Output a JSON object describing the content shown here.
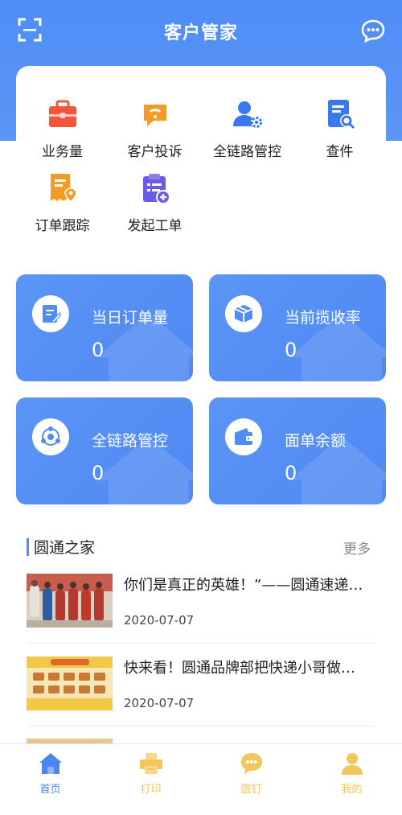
{
  "header": {
    "title": "客户管家",
    "scan_icon": "scan-icon",
    "chat_icon": "chat-bubble-icon"
  },
  "menu": {
    "items": [
      {
        "label": "业务量",
        "icon": "briefcase-icon",
        "color": "#f2553c"
      },
      {
        "label": "客户投诉",
        "icon": "complaint-chat-icon",
        "color": "#f59a22"
      },
      {
        "label": "全链路管控",
        "icon": "user-gear-icon",
        "color": "#3a78ee"
      },
      {
        "label": "查件",
        "icon": "document-search-icon",
        "color": "#3a78ee"
      },
      {
        "label": "订单跟踪",
        "icon": "order-location-icon",
        "color": "#f59a22"
      },
      {
        "label": "发起工单",
        "icon": "clipboard-add-icon",
        "color": "#6a5ce8"
      }
    ]
  },
  "stats": [
    {
      "label": "当日订单量",
      "value": "0",
      "icon": "order-edit-icon"
    },
    {
      "label": "当前揽收率",
      "value": "0",
      "icon": "box-icon"
    },
    {
      "label": "全链路管控",
      "value": "0",
      "icon": "network-icon"
    },
    {
      "label": "面单余额",
      "value": "0",
      "icon": "wallet-icon"
    }
  ],
  "news": {
    "title": "圆通之家",
    "more": "更多",
    "items": [
      {
        "title": "你们是真正的英雄！”——圆通速递…",
        "date": "2020-07-07"
      },
      {
        "title": "快来看！圆通品牌部把快递小哥做…",
        "date": "2020-07-07"
      }
    ]
  },
  "tabbar": {
    "tabs": [
      {
        "label": "首页",
        "icon": "home-icon",
        "active": true
      },
      {
        "label": "打印",
        "icon": "printer-icon",
        "active": false
      },
      {
        "label": "圆钉",
        "icon": "chat-icon",
        "active": false
      },
      {
        "label": "我的",
        "icon": "user-icon",
        "active": false
      }
    ]
  },
  "colors": {
    "brand_blue": "#4f8df5",
    "tab_active": "#4a86f0",
    "tab_inactive": "#f2c65a"
  }
}
